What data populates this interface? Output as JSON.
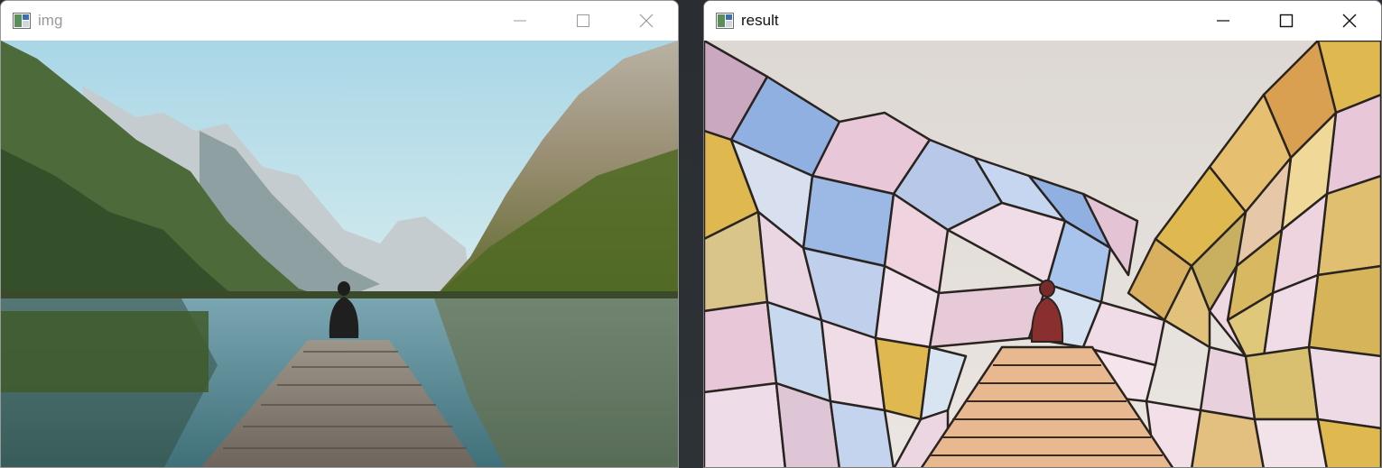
{
  "windows": [
    {
      "title": "img",
      "icon": "opencv-image-window-icon",
      "state": "inactive",
      "controls": [
        "minimize-icon",
        "maximize-icon",
        "close-icon"
      ]
    },
    {
      "title": "result",
      "icon": "opencv-image-window-icon",
      "state": "active",
      "controls": [
        "minimize-icon",
        "maximize-icon",
        "close-icon"
      ]
    }
  ],
  "colors": {
    "sky": "#bfe0ea",
    "mountain_rock": "#c9d3d6",
    "forest": "#44592e",
    "water": "#5c8a96",
    "pier": "#8a7f73",
    "glass_lead": "#2a2420",
    "glass_pink": "#e8c8d8",
    "glass_blue": "#8fb0e0",
    "glass_yellow": "#e0b850"
  }
}
